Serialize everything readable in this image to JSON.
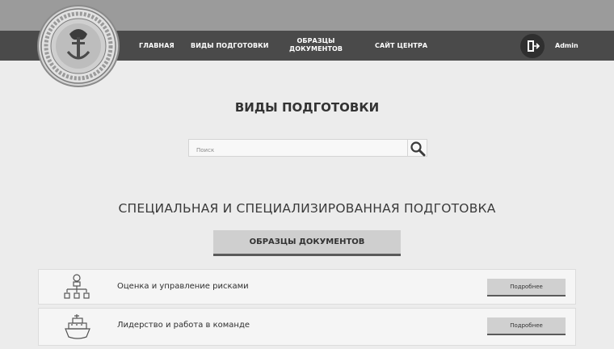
{
  "header": {
    "nav": {
      "home": "ГЛАВНАЯ",
      "training_types": "ВИДЫ ПОДГОТОВКИ",
      "documents_line1": "ОБРАЗЦЫ",
      "documents_line2": "ДОКУМЕНТОВ",
      "center_site": "САЙТ ЦЕНТРА"
    },
    "user": "Admin"
  },
  "main": {
    "title": "ВИДЫ ПОДГОТОВКИ",
    "search": {
      "placeholder": "Поиск"
    },
    "section_title": "СПЕЦИАЛЬНАЯ И СПЕЦИАЛИЗИРОВАННАЯ ПОДГОТОВКА",
    "documents_button": "ОБРАЗЦЫ ДОКУМЕНТОВ",
    "courses": [
      {
        "title": "Оценка и управление рисками",
        "icon": "hierarchy-icon",
        "button": "Подробнее"
      },
      {
        "title": "Лидерство и работа в команде",
        "icon": "ship-icon",
        "button": "Подробнее"
      }
    ]
  }
}
